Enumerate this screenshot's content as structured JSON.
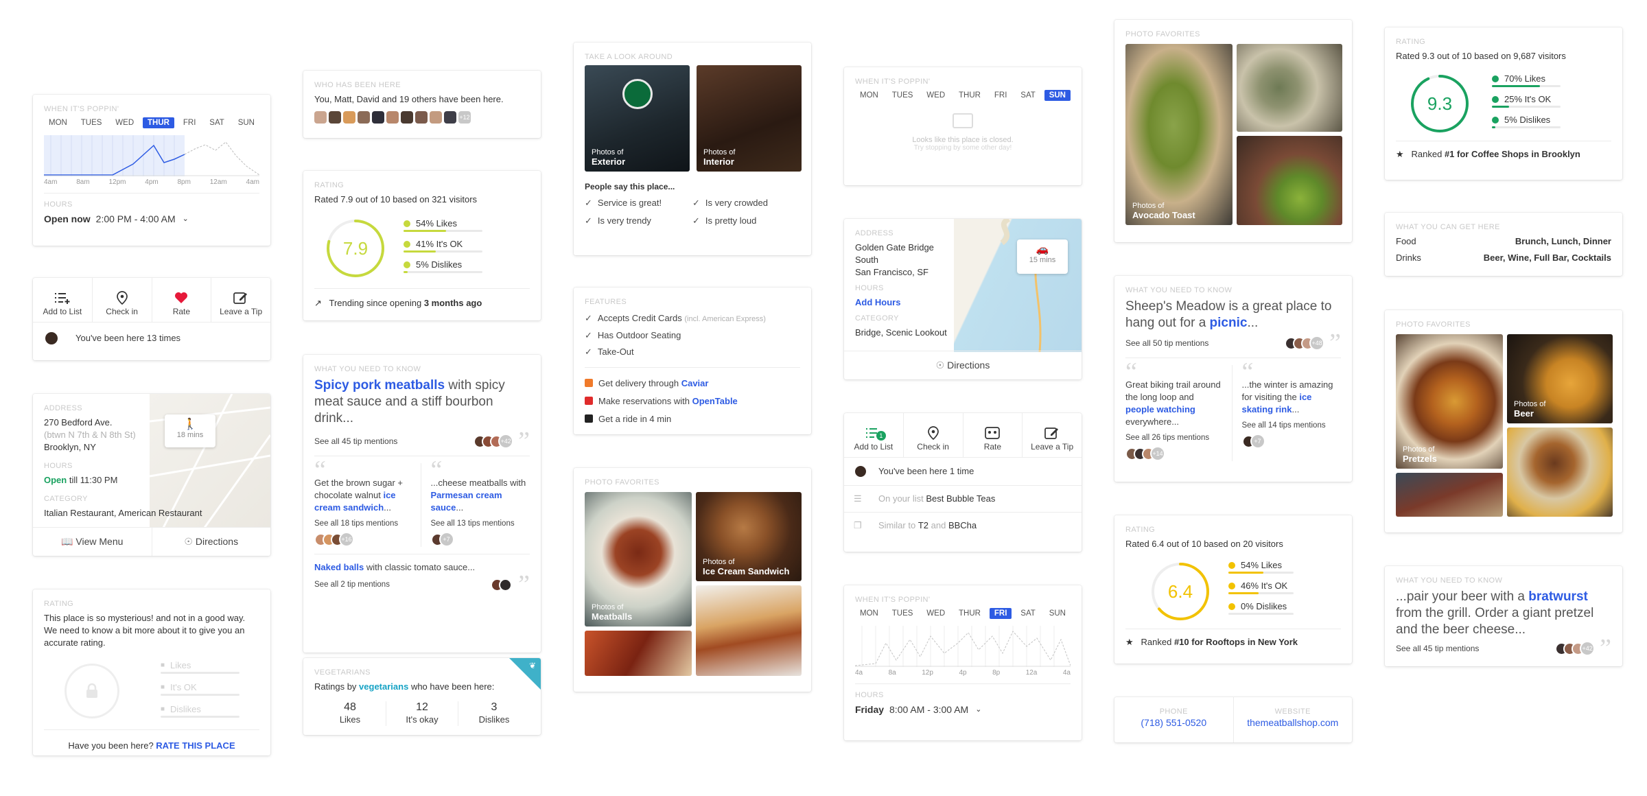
{
  "poppin1": {
    "label": "WHEN IT'S POPPIN'",
    "days": [
      "MON",
      "TUES",
      "WED",
      "THUR",
      "FRI",
      "SAT",
      "SUN"
    ],
    "selected": "THUR",
    "times": [
      "4am",
      "8am",
      "12pm",
      "4pm",
      "8pm",
      "12am",
      "4am"
    ],
    "hours_label": "HOURS",
    "open_now": "Open now",
    "hours": "2:00 PM - 4:00 AM"
  },
  "actions1": {
    "add": "Add to List",
    "checkin": "Check in",
    "rate": "Rate",
    "tip": "Leave a Tip",
    "been": "You've been here 13 times"
  },
  "address1": {
    "label": "ADDRESS",
    "line1": "270 Bedford Ave.",
    "line2": "(btwn N 7th & N 8th St)",
    "line3": "Brooklyn, NY",
    "hours_label": "HOURS",
    "open": "Open",
    "till": "till 11:30 PM",
    "category_label": "CATEGORY",
    "category": "Italian Restaurant, American Restaurant",
    "map_mins": "18 mins",
    "view_menu": "View Menu",
    "directions": "Directions"
  },
  "rating_mystery": {
    "label": "RATING",
    "text": "This place is so mysterious! and not in a good way. We need to know a bit more about it to give you an accurate rating.",
    "likes": "Likes",
    "ok": "It's OK",
    "dislikes": "Dislikes",
    "question": "Have you been here?",
    "cta": "RATE THIS PLACE"
  },
  "who": {
    "label": "WHO HAS BEEN HERE",
    "text": "You, Matt, David and 19 others have been here.",
    "more": "+12"
  },
  "rating79": {
    "label": "RATING",
    "text": "Rated 7.9 out of 10 based on 321 visitors",
    "score": "7.9",
    "score_value": 7.9,
    "likes": "54% Likes",
    "ok": "41% It's OK",
    "dislikes": "5% Dislikes",
    "likes_pct": 54,
    "ok_pct": 41,
    "dislikes_pct": 5,
    "trending": "Trending since opening",
    "trending_bold": "3 months ago"
  },
  "tips1": {
    "label": "WHAT YOU NEED TO KNOW",
    "lead": "Spicy pork meatballs",
    "rest": "with spicy meat sauce and a stiff bourbon drink...",
    "see": "See all 45 tip mentions",
    "more": "+42",
    "q1a": "Get the brown sugar + chocolate walnut",
    "q1b": "ice cream sandwich",
    "q1c": "...",
    "q1see": "See all 18 tips mentions",
    "q1more": "+16",
    "q2a": "...cheese meatballs with",
    "q2b": "Parmesan cream sauce",
    "q2c": "...",
    "q2see": "See all 13 tips mentions",
    "q2more": "+7",
    "naked": "Naked balls",
    "naked_rest": "with classic tomato sauce...",
    "naked_see": "See all 2 tip mentions"
  },
  "veg": {
    "label": "VEGETARIANS",
    "text_a": "Ratings by",
    "text_b": "vegetarians",
    "text_c": "who have been here:",
    "likes_n": "48",
    "likes": "Likes",
    "ok_n": "12",
    "ok": "It's okay",
    "dis_n": "3",
    "dis": "Dislikes"
  },
  "look": {
    "label": "TAKE A LOOK AROUND",
    "ext_small": "Photos of",
    "ext": "Exterior",
    "int_small": "Photos of",
    "int": "Interior",
    "say": "People say this place...",
    "t1": "Service is great!",
    "t2": "Is very crowded",
    "t3": "Is very trendy",
    "t4": "Is pretty loud"
  },
  "features": {
    "label": "FEATURES",
    "f1": "Accepts Credit Cards",
    "f1b": "(incl. American Express)",
    "f2": "Has Outdoor Seating",
    "f3": "Take-Out",
    "d1": "Get delivery through",
    "d1b": "Caviar",
    "d2": "Make reservations with",
    "d2b": "OpenTable",
    "d3": "Get a ride in 4 min"
  },
  "photos_mid": {
    "label": "PHOTO FAVORITES",
    "meat_small": "Photos of",
    "meat": "Meatballs",
    "ice_small": "Photos of",
    "ice": "Ice Cream Sandwich"
  },
  "poppin_closed": {
    "label": "WHEN IT'S POPPIN'",
    "days": [
      "MON",
      "TUES",
      "WED",
      "THUR",
      "FRI",
      "SAT",
      "SUN"
    ],
    "selected": "SUN",
    "closed": "Looks like this place is closed.",
    "closed2": "Try stopping by some other day!"
  },
  "address2": {
    "label": "ADDRESS",
    "line1": "Golden Gate Bridge",
    "line2": "South",
    "line3": "San Francisco, SF",
    "hours_label": "HOURS",
    "add_hours": "Add Hours",
    "category_label": "CATEGORY",
    "category": "Bridge, Scenic Lookout",
    "mins": "15 mins",
    "directions": "Directions"
  },
  "actions2": {
    "add": "Add to List",
    "checkin": "Check in",
    "rate": "Rate",
    "tip": "Leave a Tip",
    "been": "You've been here 1 time",
    "list_a": "On your list",
    "list_b": "Best Bubble Teas",
    "sim_a": "Similar to",
    "sim_b": "T2",
    "sim_c": "and",
    "sim_d": "BBCha",
    "badge": "1"
  },
  "poppin2": {
    "label": "WHEN IT'S POPPIN'",
    "days": [
      "MON",
      "TUES",
      "WED",
      "THUR",
      "FRI",
      "SAT",
      "SUN"
    ],
    "selected": "FRI",
    "times": [
      "4a",
      "8a",
      "12p",
      "4p",
      "8p",
      "12a",
      "4a"
    ],
    "hours_label": "HOURS",
    "day": "Friday",
    "hours": "8:00 AM - 3:00 AM"
  },
  "photos_right": {
    "label": "PHOTO FAVORITES",
    "small": "Photos of",
    "name": "Avocado Toast"
  },
  "tips2": {
    "label": "WHAT YOU NEED TO KNOW",
    "lead_a": "Sheep's Meadow is a great place to hang out for a",
    "lead_b": "picnic",
    "lead_c": "...",
    "see": "See all 50 tip mentions",
    "more": "+48",
    "q1a": "Great biking trail around the long loop and",
    "q1b": "people watching",
    "q1c": "everywhere...",
    "q1see": "See all 26 tips mentions",
    "q1more": "+14",
    "q2a": "...the winter is amazing for visiting the",
    "q2b": "ice skating rink",
    "q2c": "...",
    "q2see": "See all 14 tips mentions",
    "q2more": "+7"
  },
  "rating64": {
    "label": "RATING",
    "text": "Rated 6.4 out of 10 based on 20 visitors",
    "score": "6.4",
    "score_value": 6.4,
    "likes": "54% Likes",
    "ok": "46% It's OK",
    "dislikes": "0% Dislikes",
    "likes_pct": 54,
    "ok_pct": 46,
    "dislikes_pct": 0,
    "ranked_a": "Ranked",
    "ranked_b": "#10 for Rooftops in New York"
  },
  "contact": {
    "phone_label": "PHONE",
    "phone": "(718) 551-0520",
    "web_label": "WEBSITE",
    "web": "themeatballshop.com"
  },
  "rating93": {
    "label": "RATING",
    "text": "Rated 9.3 out of 10 based on 9,687 visitors",
    "score": "9.3",
    "score_value": 9.3,
    "likes": "70% Likes",
    "ok": "25% It's OK",
    "dislikes": "5% Dislikes",
    "likes_pct": 70,
    "ok_pct": 25,
    "dislikes_pct": 5,
    "ranked_a": "Ranked",
    "ranked_b": "#1 for Coffee Shops in Brooklyn"
  },
  "getHere": {
    "label": "WHAT YOU CAN GET HERE",
    "food": "Food",
    "food_v": "Brunch, Lunch, Dinner",
    "drinks": "Drinks",
    "drinks_v": "Beer, Wine, Full Bar, Cocktails"
  },
  "photos_far": {
    "label": "PHOTO FAVORITES",
    "beer_small": "Photos of",
    "beer": "Beer",
    "pretzel_small": "Photos of",
    "pretzel": "Pretzels"
  },
  "tips3": {
    "label": "WHAT YOU NEED TO KNOW",
    "a": "...pair your beer with a",
    "b": "bratwurst",
    "c": "from the grill. Order a giant pretzel and the beer cheese...",
    "see": "See all 45 tip mentions",
    "more": "+42"
  },
  "colors": {
    "blue": "#2d5be3",
    "green": "#1aa260",
    "lime": "#c6d93d",
    "yellow": "#f2c200",
    "red": "#e6193a"
  }
}
